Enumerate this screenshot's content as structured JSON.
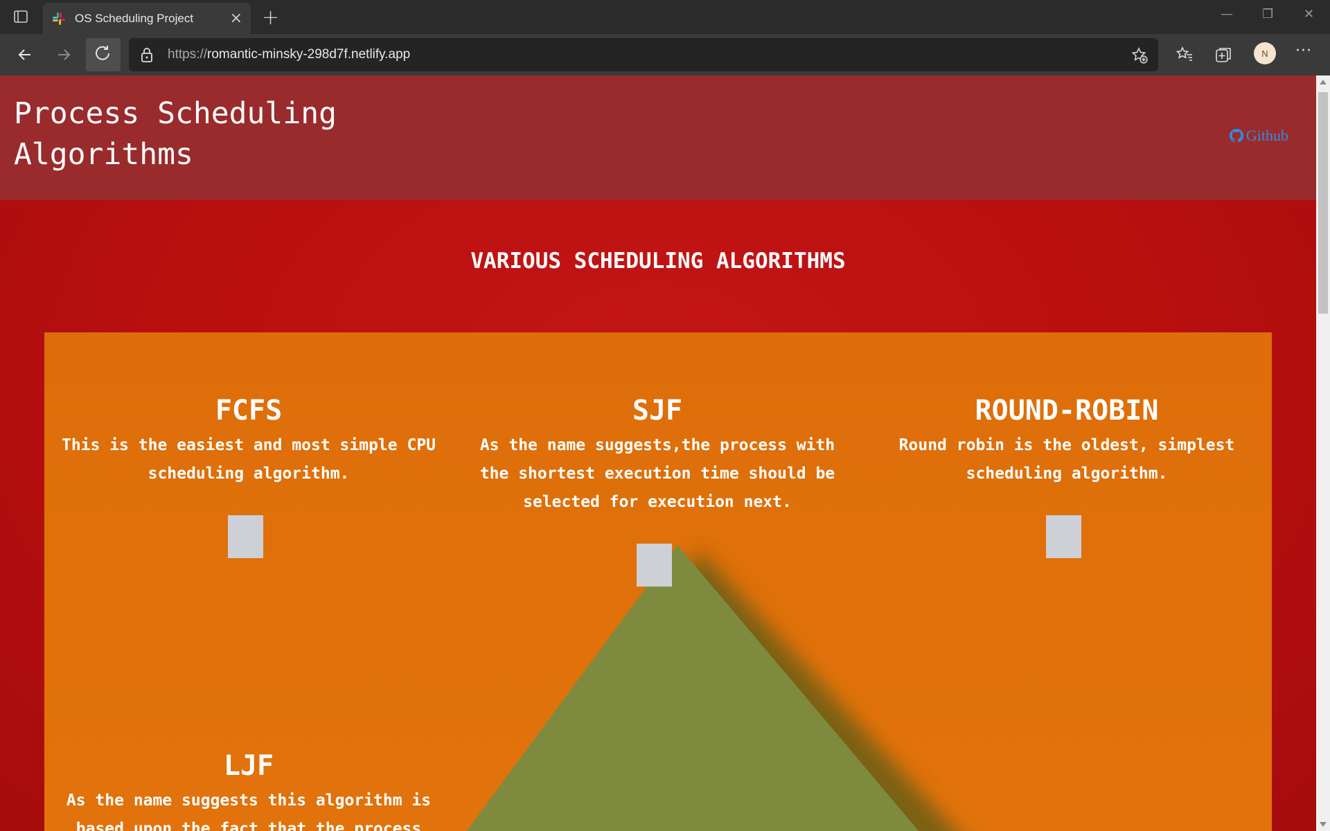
{
  "browser": {
    "tab_title": "OS Scheduling Project",
    "url_protocol": "https://",
    "url_host": "romantic-minsky-298d7f.netlify.app",
    "profile_initial": "N"
  },
  "site": {
    "title_line1": "Process Scheduling",
    "title_line2": "Algorithms",
    "github_label": "Github"
  },
  "main": {
    "heading": "VARIOUS SCHEDULING ALGORITHMS",
    "algorithms": [
      {
        "name": "FCFS",
        "description": "This is the easiest and most simple CPU scheduling algorithm."
      },
      {
        "name": "SJF",
        "description": "As the name suggests,the process with the shortest execution time should be selected for execution next."
      },
      {
        "name": "ROUND-ROBIN",
        "description": "Round robin is the oldest, simplest scheduling algorithm."
      },
      {
        "name": "LJF",
        "description": "As the name suggests this algorithm is based upon the fact that the process with"
      }
    ]
  },
  "colors": {
    "page_bg": "#b80f0f",
    "header_bg": "#9a2b2c",
    "panel_bg": "#e0700b",
    "pyramid": "#7e8b3f",
    "link": "#2d8ee8"
  }
}
